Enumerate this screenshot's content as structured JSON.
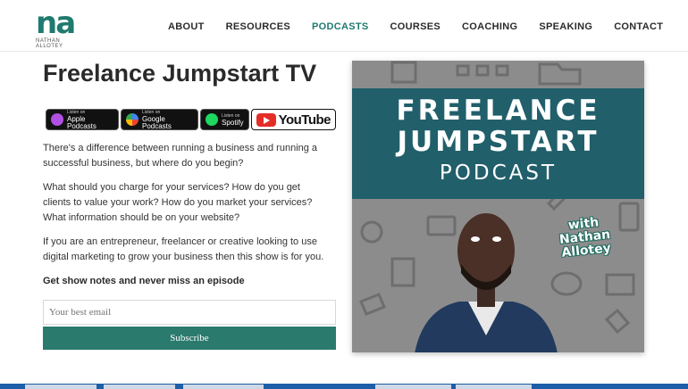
{
  "logo": {
    "mark": "na",
    "sub": "NATHAN ALLOTEY"
  },
  "nav": [
    {
      "label": "ABOUT",
      "active": false
    },
    {
      "label": "RESOURCES",
      "active": false
    },
    {
      "label": "PODCASTS",
      "active": true
    },
    {
      "label": "COURSES",
      "active": false
    },
    {
      "label": "COACHING",
      "active": false
    },
    {
      "label": "SPEAKING",
      "active": false
    },
    {
      "label": "CONTACT",
      "active": false
    }
  ],
  "main": {
    "title": "Freelance Jumpstart TV",
    "badges": {
      "apple": {
        "small": "Listen on",
        "big": "Apple Podcasts"
      },
      "google": {
        "small": "Listen on",
        "big": "Google Podcasts"
      },
      "spotify": {
        "small": "Listen on",
        "big": "Spotify"
      },
      "youtube": {
        "big": "YouTube"
      }
    },
    "paragraphs": [
      "There's a difference between running a business and running a successful business, but where do you begin?",
      "What should you charge for your services? How do you get clients to value your work? How do you market your services? What information should be on your website?",
      "If you are an entrepreneur, freelancer or creative looking to use digital marketing to grow your business then this show is for you."
    ],
    "cta": "Get show notes and never miss an episode",
    "email_placeholder": "Your best email",
    "subscribe_label": "Subscribe"
  },
  "art": {
    "line1": "FREELANCE",
    "line2": "JUMPSTART",
    "line3": "PODCAST",
    "with_line1": "with",
    "with_line2": "Nathan",
    "with_line3": "Allotey"
  },
  "colors": {
    "brand": "#1f7a6f",
    "band": "#215f6b",
    "button": "#2b7a6e"
  }
}
